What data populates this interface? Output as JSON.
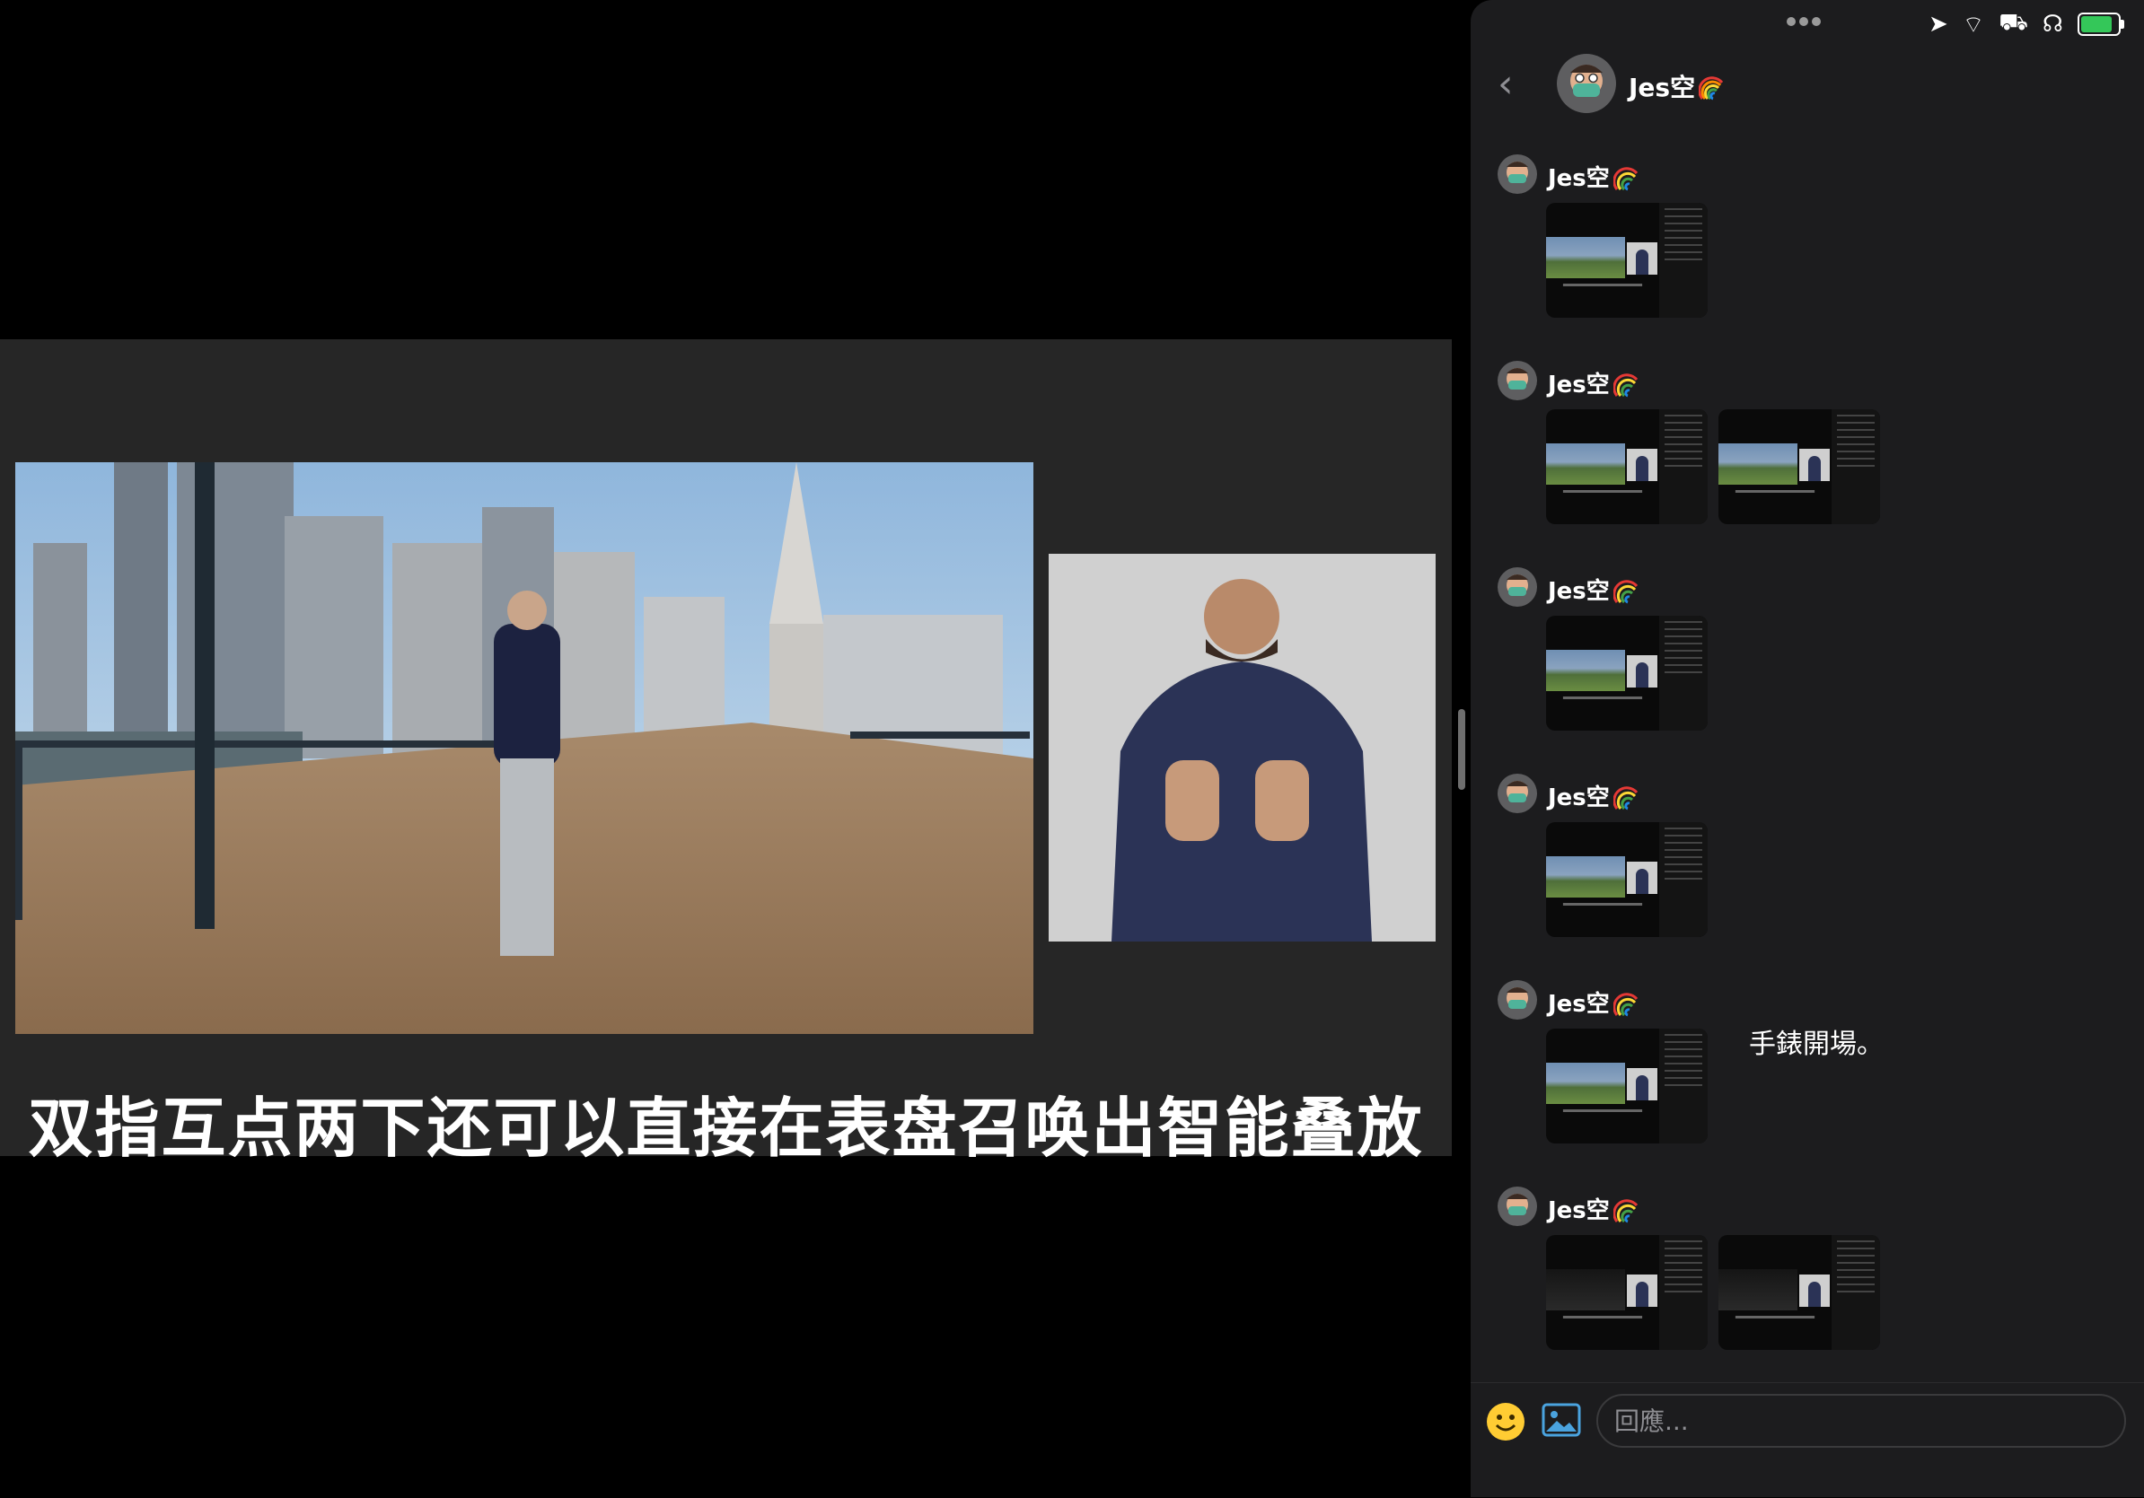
{
  "video": {
    "subtitle": "双指互点两下还可以直接在表盘召唤出智能叠放"
  },
  "chat": {
    "header": {
      "name": "Jes空",
      "back_icon": "chevron-left-icon",
      "emoji_icon": "rainbow-icon"
    },
    "status_bar": {
      "icons": [
        "location-icon",
        "wifi-icon",
        "car-icon",
        "headphones-icon",
        "battery-charging-icon"
      ]
    },
    "messages": [
      {
        "sender": "Jes空",
        "attachments": 1,
        "text": ""
      },
      {
        "sender": "Jes空",
        "attachments": 2,
        "text": ""
      },
      {
        "sender": "Jes空",
        "attachments": 1,
        "text": ""
      },
      {
        "sender": "Jes空",
        "attachments": 1,
        "text": ""
      },
      {
        "sender": "Jes空",
        "attachments": 1,
        "text": "手錶開場。"
      },
      {
        "sender": "Jes空",
        "attachments": 2,
        "text": ""
      }
    ],
    "composer": {
      "placeholder": "回應...",
      "emoji_icon": "smiley-icon",
      "image_icon": "photo-icon"
    }
  }
}
